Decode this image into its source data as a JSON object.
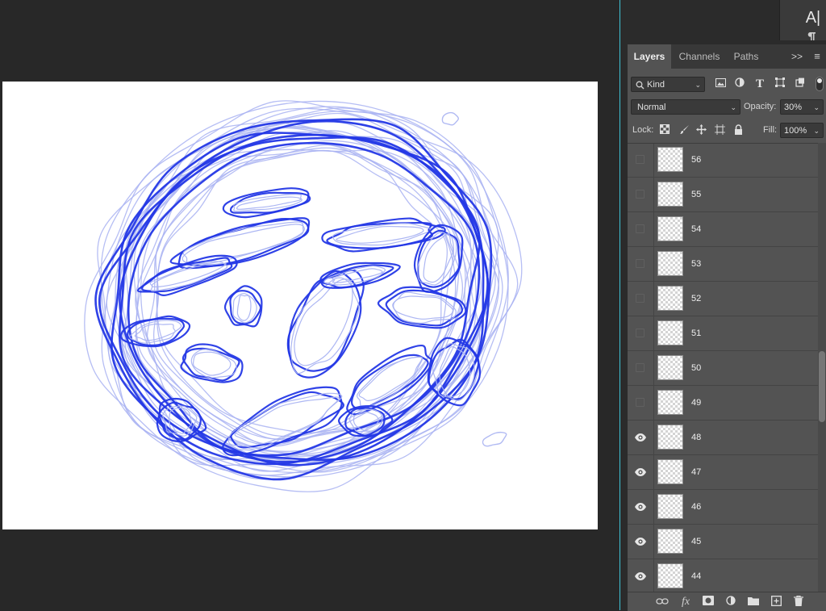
{
  "toolbar": {
    "type_tool_glyph": "A|"
  },
  "layers_panel": {
    "tabs": [
      {
        "label": "Layers",
        "active": true
      },
      {
        "label": "Channels",
        "active": false
      },
      {
        "label": "Paths",
        "active": false
      }
    ],
    "collapse_glyph": ">>",
    "menu_glyph": "≡",
    "filter": {
      "kind_label": "Kind",
      "filter_icons": [
        "image-filter-icon",
        "adjustment-filter-icon",
        "type-filter-icon",
        "shape-filter-icon",
        "smart-object-filter-icon"
      ]
    },
    "blend_mode": "Normal",
    "opacity_label": "Opacity:",
    "opacity_value": "30%",
    "lock_label": "Lock:",
    "fill_label": "Fill:",
    "fill_value": "100%",
    "layers": [
      {
        "name": "56",
        "visible": false
      },
      {
        "name": "55",
        "visible": false
      },
      {
        "name": "54",
        "visible": false
      },
      {
        "name": "53",
        "visible": false
      },
      {
        "name": "52",
        "visible": false
      },
      {
        "name": "51",
        "visible": false
      },
      {
        "name": "50",
        "visible": false
      },
      {
        "name": "49",
        "visible": false
      },
      {
        "name": "48",
        "visible": true
      },
      {
        "name": "47",
        "visible": true
      },
      {
        "name": "46",
        "visible": true
      },
      {
        "name": "45",
        "visible": true
      },
      {
        "name": "44",
        "visible": true
      }
    ],
    "footer_icons": [
      "link-layers-icon",
      "fx-icon",
      "layer-mask-icon",
      "adjustment-layer-icon",
      "group-folder-icon",
      "new-layer-icon",
      "trash-icon"
    ],
    "fx_glyph": "fx"
  },
  "canvas": {
    "stroke_color_dark": "#2438e6",
    "stroke_color_light": "#a9b3f2"
  }
}
